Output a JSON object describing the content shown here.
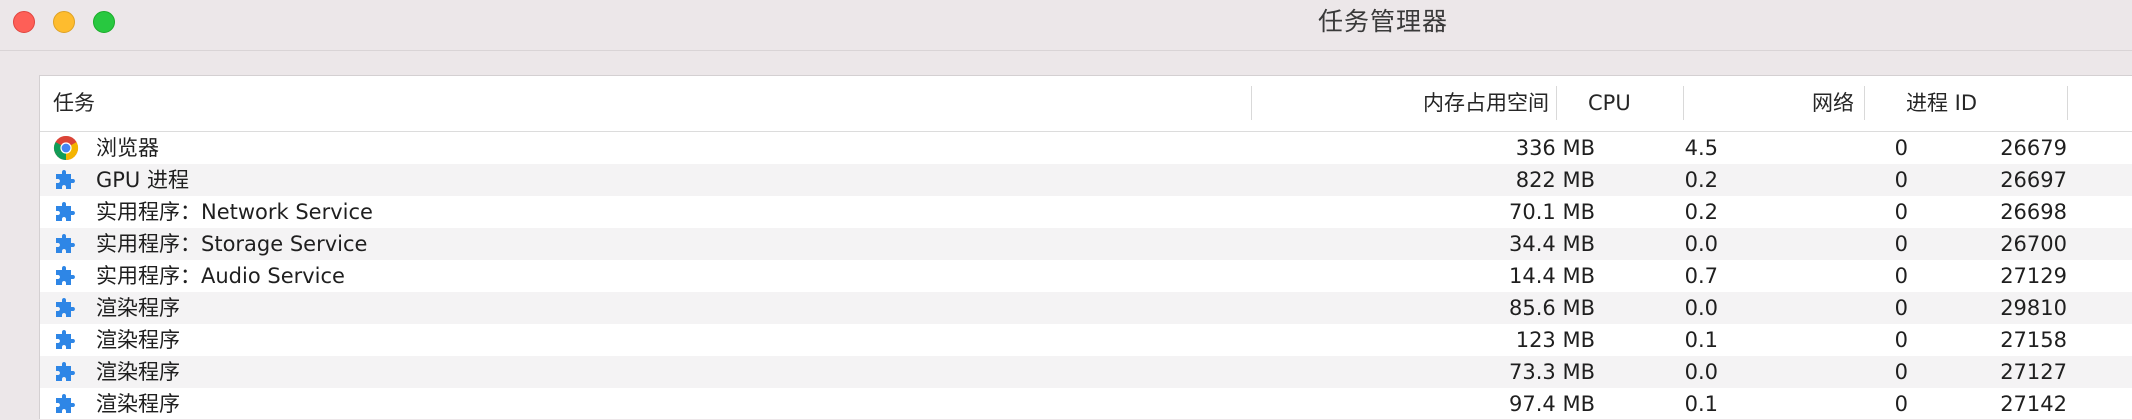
{
  "window": {
    "title": "任务管理器"
  },
  "table": {
    "columns": {
      "task": "任务",
      "memory": "内存占用空间",
      "cpu": "CPU",
      "network": "网络",
      "pid": "进程 ID"
    },
    "rows": [
      {
        "icon": "chrome-icon",
        "name": "浏览器",
        "memory": "336 MB",
        "cpu": "4.5",
        "network": "0",
        "pid": "26679"
      },
      {
        "icon": "puzzle-piece-icon",
        "name": "GPU 进程",
        "memory": "822 MB",
        "cpu": "0.2",
        "network": "0",
        "pid": "26697"
      },
      {
        "icon": "puzzle-piece-icon",
        "name": "实用程序：Network Service",
        "memory": "70.1 MB",
        "cpu": "0.2",
        "network": "0",
        "pid": "26698"
      },
      {
        "icon": "puzzle-piece-icon",
        "name": "实用程序：Storage Service",
        "memory": "34.4 MB",
        "cpu": "0.0",
        "network": "0",
        "pid": "26700"
      },
      {
        "icon": "puzzle-piece-icon",
        "name": "实用程序：Audio Service",
        "memory": "14.4 MB",
        "cpu": "0.7",
        "network": "0",
        "pid": "27129"
      },
      {
        "icon": "puzzle-piece-icon",
        "name": "渲染程序",
        "memory": "85.6 MB",
        "cpu": "0.0",
        "network": "0",
        "pid": "29810"
      },
      {
        "icon": "puzzle-piece-icon",
        "name": "渲染程序",
        "memory": "123 MB",
        "cpu": "0.1",
        "network": "0",
        "pid": "27158"
      },
      {
        "icon": "puzzle-piece-icon",
        "name": "渲染程序",
        "memory": "73.3 MB",
        "cpu": "0.0",
        "network": "0",
        "pid": "27127"
      },
      {
        "icon": "puzzle-piece-icon",
        "name": "渲染程序",
        "memory": "97.4 MB",
        "cpu": "0.1",
        "network": "0",
        "pid": "27142"
      }
    ]
  },
  "colors": {
    "close": "#fe5f57",
    "minimize": "#febc2e",
    "maximize": "#28c840",
    "puzzle_icon": "#2e86e6",
    "row_alt": "#f4f3f4"
  }
}
